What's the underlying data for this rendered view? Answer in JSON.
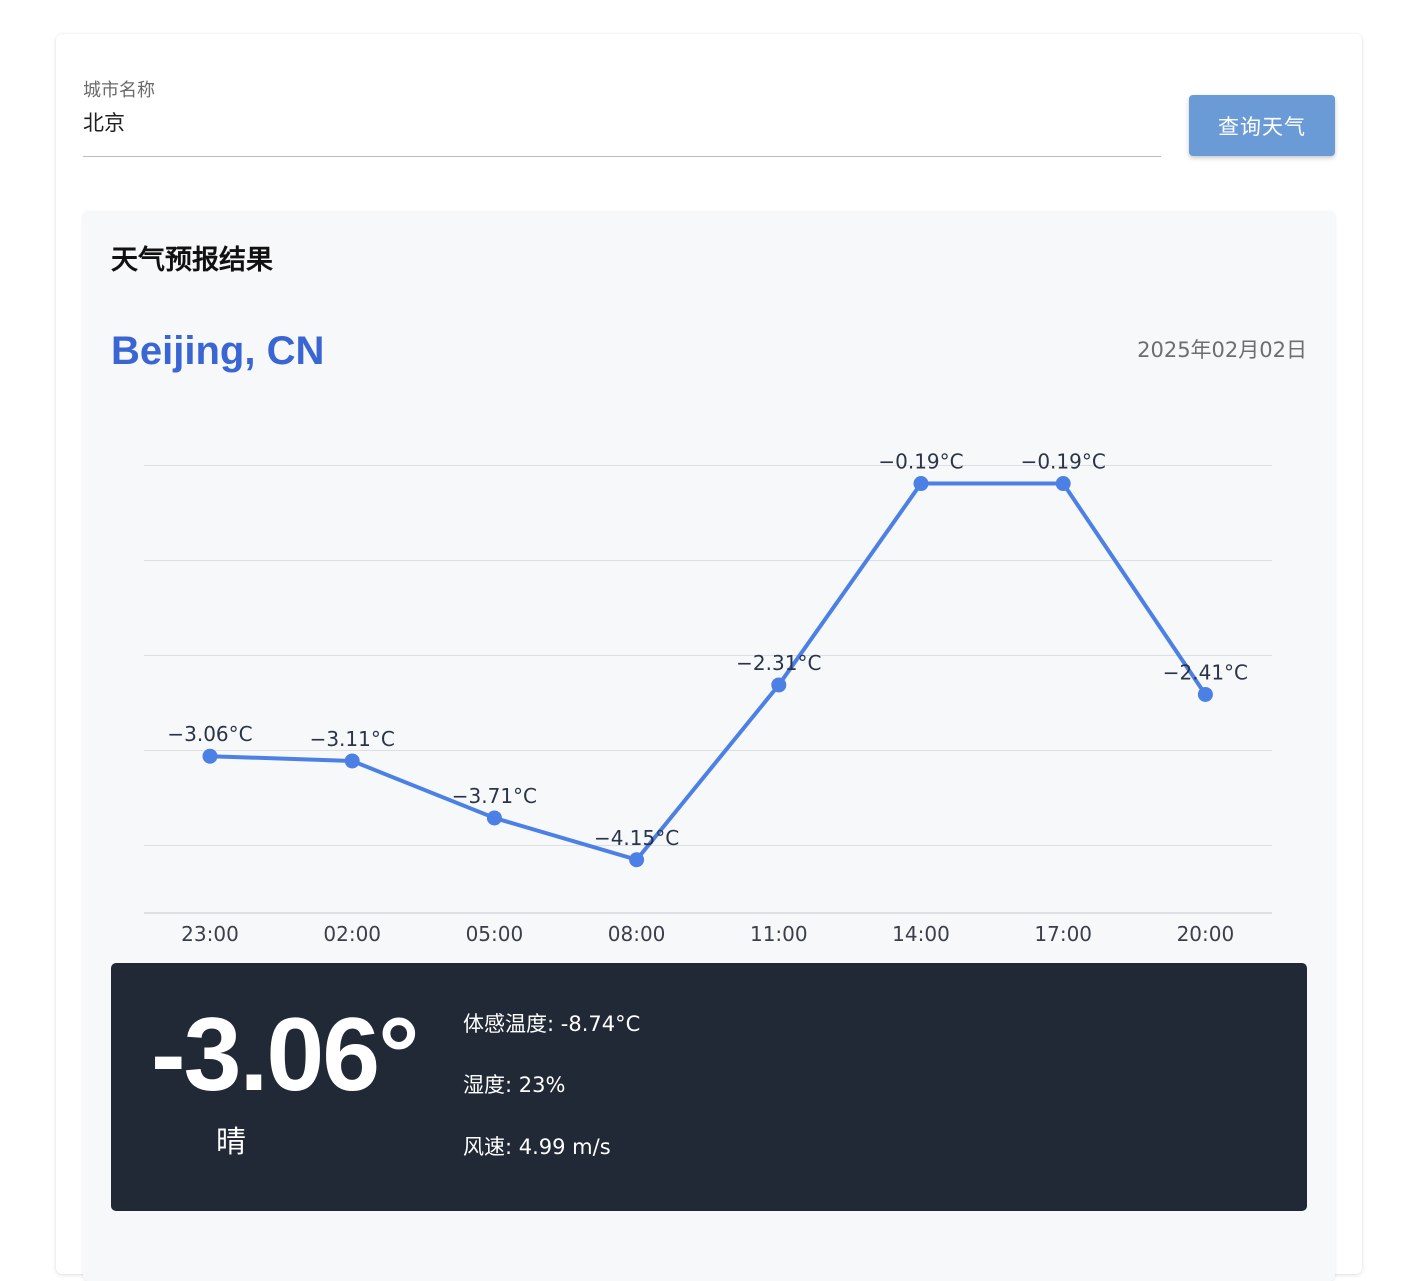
{
  "search": {
    "label": "城市名称",
    "value": "北京",
    "button_label": "查询天气"
  },
  "result": {
    "title": "天气预报结果",
    "location": "Beijing, CN",
    "date": "2025年02月02日"
  },
  "chart_data": {
    "type": "line",
    "categories": [
      "23:00",
      "02:00",
      "05:00",
      "08:00",
      "11:00",
      "14:00",
      "17:00",
      "20:00"
    ],
    "values": [
      -3.06,
      -3.11,
      -3.71,
      -4.15,
      -2.31,
      -0.19,
      -0.19,
      -2.41
    ],
    "point_labels": [
      "−3.06°C",
      "−3.11°C",
      "−3.71°C",
      "−4.15°C",
      "−2.31°C",
      "−0.19°C",
      "−0.19°C",
      "−2.41°C"
    ],
    "ylim": [
      -4.5,
      0
    ],
    "grid": true,
    "line_color": "#4d80e4"
  },
  "current": {
    "temperature": "-3.06°",
    "condition": "晴",
    "feels_like": "体感温度: -8.74°C",
    "humidity": "湿度: 23%",
    "wind": "风速: 4.99 m/s"
  }
}
